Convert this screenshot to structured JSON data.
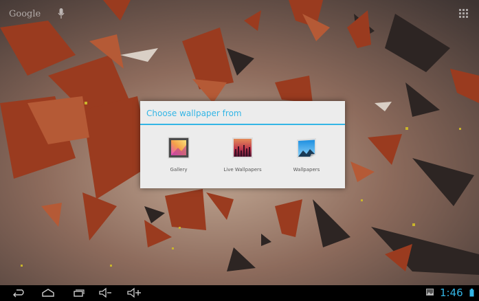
{
  "home": {
    "search_logo": "Google",
    "mic_icon": "mic-icon",
    "apps_icon": "apps-grid-icon"
  },
  "dialog": {
    "title": "Choose wallpaper from",
    "accent_color": "#33b5e5",
    "options": [
      {
        "label": "Gallery",
        "icon": "gallery-icon"
      },
      {
        "label": "Live Wallpapers",
        "icon": "live-wallpapers-icon"
      },
      {
        "label": "Wallpapers",
        "icon": "wallpapers-icon"
      }
    ]
  },
  "navbar": {
    "buttons": [
      "back-icon",
      "home-icon",
      "recent-apps-icon",
      "volume-down-icon",
      "volume-up-icon"
    ],
    "clock": "1:46",
    "status_icons": [
      "screenshot-notification-icon",
      "battery-icon"
    ]
  }
}
